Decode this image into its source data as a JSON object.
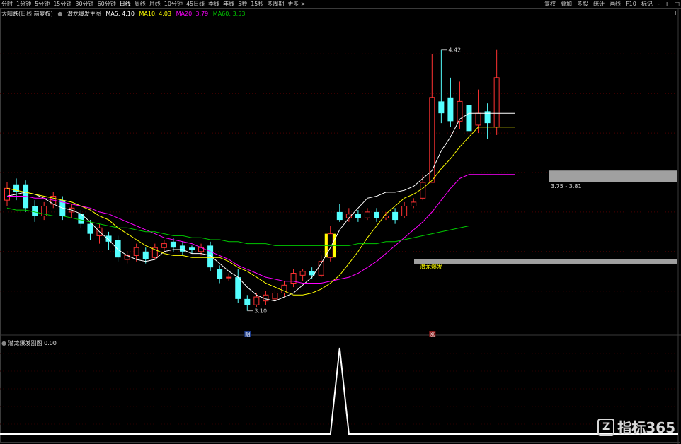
{
  "toolbar": {
    "periods": [
      {
        "label": "分时"
      },
      {
        "label": "1分钟"
      },
      {
        "label": "5分钟"
      },
      {
        "label": "15分钟"
      },
      {
        "label": "30分钟"
      },
      {
        "label": "60分钟"
      },
      {
        "label": "日线",
        "active": true
      },
      {
        "label": "周线"
      },
      {
        "label": "月线"
      },
      {
        "label": "10分钟"
      },
      {
        "label": "45日线"
      },
      {
        "label": "季线"
      },
      {
        "label": "年线"
      },
      {
        "label": "5秒"
      },
      {
        "label": "15秒"
      },
      {
        "label": "多周期"
      },
      {
        "label": "更多 >"
      }
    ],
    "right": [
      "复权",
      "叠加",
      "多股",
      "统计",
      "画线",
      "F10",
      "标记",
      "-",
      "+",
      "□"
    ]
  },
  "main_legend": {
    "period_label": "大阳跌(日线 前复权)",
    "indicator_name": "潜龙爆发主图",
    "ma5": "MA5: 4.10",
    "ma10": "MA10: 4.03",
    "ma20": "MA20: 3.79",
    "ma60": "MA60: 3.53"
  },
  "sub_legend": {
    "indicator_name": "潜龙爆发副图",
    "value": "0.00"
  },
  "annotations": {
    "high_price": "4.42",
    "low_price": "3.10",
    "zone_label": "3.75 - 3.81",
    "signal_label": "潜龙爆发"
  },
  "markers": {
    "low_marker": "阴",
    "limit_up_marker": "涨"
  },
  "watermark": {
    "logo_glyph": "Z",
    "brand": "指标365"
  },
  "colors": {
    "up": "#ff3232",
    "down": "#54ffff",
    "ma5": "#ffffff",
    "ma10": "#ffff00",
    "ma20": "#ff00ff",
    "ma60": "#00c800",
    "zone": "#a0a0a0",
    "signal": "#ffff00",
    "signal_text": "#ffff00"
  },
  "chart_data": {
    "type": "candlestick",
    "title": "潜龙爆发主图",
    "series": [
      {
        "name": "MA5",
        "values": [
          3.68,
          3.69,
          3.7,
          3.69,
          3.67,
          3.64,
          3.62,
          3.61,
          3.59,
          3.55,
          3.5,
          3.46,
          3.41,
          3.38,
          3.36,
          3.35,
          3.36,
          3.4,
          3.41,
          3.41,
          3.39,
          3.39,
          3.38,
          3.34,
          3.3,
          3.27,
          3.22,
          3.18,
          3.16,
          3.15,
          3.17,
          3.19,
          3.23,
          3.27,
          3.34,
          3.42,
          3.51,
          3.57,
          3.62,
          3.67,
          3.68,
          3.7,
          3.7,
          3.71,
          3.73,
          3.77,
          3.81,
          3.91,
          3.98,
          4.07,
          4.1,
          4.1,
          4.1,
          4.1,
          4.1,
          4.1
        ]
      },
      {
        "name": "MA10",
        "values": [
          3.72,
          3.71,
          3.7,
          3.69,
          3.68,
          3.67,
          3.66,
          3.65,
          3.63,
          3.61,
          3.58,
          3.56,
          3.52,
          3.49,
          3.46,
          3.43,
          3.41,
          3.39,
          3.38,
          3.38,
          3.37,
          3.37,
          3.37,
          3.37,
          3.35,
          3.32,
          3.3,
          3.27,
          3.24,
          3.22,
          3.2,
          3.18,
          3.18,
          3.19,
          3.21,
          3.24,
          3.28,
          3.34,
          3.4,
          3.47,
          3.53,
          3.59,
          3.63,
          3.67,
          3.69,
          3.72,
          3.76,
          3.82,
          3.87,
          3.93,
          3.98,
          4.03,
          4.03,
          4.03,
          4.03,
          4.03
        ]
      },
      {
        "name": "MA20",
        "values": [
          3.68,
          3.68,
          3.68,
          3.67,
          3.67,
          3.66,
          3.65,
          3.64,
          3.63,
          3.62,
          3.6,
          3.59,
          3.57,
          3.55,
          3.53,
          3.51,
          3.49,
          3.47,
          3.46,
          3.45,
          3.44,
          3.42,
          3.4,
          3.38,
          3.36,
          3.33,
          3.31,
          3.29,
          3.27,
          3.26,
          3.25,
          3.25,
          3.24,
          3.24,
          3.24,
          3.25,
          3.26,
          3.27,
          3.29,
          3.32,
          3.35,
          3.39,
          3.43,
          3.47,
          3.51,
          3.55,
          3.6,
          3.66,
          3.72,
          3.77,
          3.79,
          3.79,
          3.79,
          3.79,
          3.79,
          3.79
        ]
      },
      {
        "name": "MA60",
        "values": [
          3.62,
          3.61,
          3.61,
          3.6,
          3.59,
          3.58,
          3.58,
          3.57,
          3.56,
          3.55,
          3.54,
          3.53,
          3.52,
          3.52,
          3.51,
          3.5,
          3.5,
          3.49,
          3.48,
          3.48,
          3.47,
          3.47,
          3.46,
          3.46,
          3.45,
          3.45,
          3.44,
          3.44,
          3.44,
          3.43,
          3.43,
          3.43,
          3.43,
          3.43,
          3.43,
          3.43,
          3.43,
          3.43,
          3.44,
          3.44,
          3.44,
          3.45,
          3.45,
          3.46,
          3.47,
          3.48,
          3.49,
          3.5,
          3.51,
          3.52,
          3.53,
          3.53,
          3.53,
          3.53,
          3.53,
          3.53
        ]
      }
    ],
    "candles": [
      [
        3.66,
        3.72,
        3.75,
        3.63
      ],
      [
        3.74,
        3.7,
        3.77,
        3.66
      ],
      [
        3.74,
        3.62,
        3.76,
        3.6
      ],
      [
        3.63,
        3.58,
        3.66,
        3.55
      ],
      [
        3.58,
        3.63,
        3.65,
        3.56
      ],
      [
        3.64,
        3.68,
        3.7,
        3.62
      ],
      [
        3.66,
        3.58,
        3.68,
        3.56
      ],
      [
        3.6,
        3.62,
        3.64,
        3.57
      ],
      [
        3.59,
        3.54,
        3.61,
        3.52
      ],
      [
        3.54,
        3.49,
        3.56,
        3.46
      ],
      [
        3.48,
        3.52,
        3.54,
        3.44
      ],
      [
        3.48,
        3.45,
        3.5,
        3.41
      ],
      [
        3.46,
        3.37,
        3.48,
        3.35
      ],
      [
        3.36,
        3.38,
        3.4,
        3.34
      ],
      [
        3.38,
        3.42,
        3.44,
        3.35
      ],
      [
        3.4,
        3.36,
        3.42,
        3.34
      ],
      [
        3.37,
        3.42,
        3.44,
        3.36
      ],
      [
        3.42,
        3.44,
        3.46,
        3.4
      ],
      [
        3.45,
        3.42,
        3.47,
        3.4
      ],
      [
        3.43,
        3.4,
        3.45,
        3.38
      ],
      [
        3.42,
        3.41,
        3.43,
        3.39
      ],
      [
        3.4,
        3.42,
        3.44,
        3.38
      ],
      [
        3.43,
        3.32,
        3.45,
        3.3
      ],
      [
        3.31,
        3.26,
        3.33,
        3.24
      ],
      [
        3.27,
        3.27,
        3.29,
        3.25
      ],
      [
        3.27,
        3.16,
        3.31,
        3.14
      ],
      [
        3.16,
        3.13,
        3.18,
        3.1
      ],
      [
        3.13,
        3.17,
        3.19,
        3.12
      ],
      [
        3.15,
        3.18,
        3.2,
        3.13
      ],
      [
        3.16,
        3.19,
        3.21,
        3.14
      ],
      [
        3.19,
        3.23,
        3.25,
        3.17
      ],
      [
        3.24,
        3.29,
        3.31,
        3.22
      ],
      [
        3.28,
        3.3,
        3.31,
        3.25
      ],
      [
        3.3,
        3.28,
        3.32,
        3.26
      ],
      [
        3.28,
        3.35,
        3.38,
        3.27
      ],
      [
        3.37,
        3.49,
        3.53,
        3.35
      ],
      [
        3.6,
        3.56,
        3.64,
        3.55
      ],
      [
        3.57,
        3.59,
        3.62,
        3.55
      ],
      [
        3.59,
        3.57,
        3.61,
        3.55
      ],
      [
        3.57,
        3.6,
        3.62,
        3.56
      ],
      [
        3.6,
        3.57,
        3.62,
        3.55
      ],
      [
        3.57,
        3.58,
        3.6,
        3.56
      ],
      [
        3.6,
        3.56,
        3.62,
        3.54
      ],
      [
        3.58,
        3.63,
        3.65,
        3.57
      ],
      [
        3.63,
        3.65,
        3.67,
        3.62
      ],
      [
        3.67,
        3.75,
        3.79,
        3.66
      ],
      [
        3.75,
        4.18,
        4.4,
        3.75
      ],
      [
        4.16,
        4.1,
        4.42,
        4.05
      ],
      [
        4.18,
        4.06,
        4.28,
        4.03
      ],
      [
        4.06,
        4.16,
        4.26,
        4.02
      ],
      [
        4.14,
        4.01,
        4.27,
        3.98
      ],
      [
        4.04,
        4.1,
        4.22,
        4.0
      ],
      [
        4.11,
        4.05,
        4.15,
        3.97
      ],
      [
        4.03,
        4.28,
        4.42,
        3.99
      ]
    ],
    "ylim": [
      3.02,
      4.58
    ],
    "zones": [
      {
        "label": "3.75 - 3.81",
        "low": 3.75,
        "high": 3.81
      },
      {
        "label": "潜龙爆发",
        "low": 3.35,
        "high": 3.36
      }
    ],
    "signal_bars": [
      {
        "index": 35,
        "low": 3.37,
        "high": 3.49
      }
    ],
    "sub_chart": {
      "title": "潜龙爆发副图",
      "values": [
        0,
        0,
        0,
        0,
        0,
        0,
        0,
        0,
        0,
        0,
        0,
        0,
        0,
        0,
        0,
        0,
        0,
        0,
        0,
        0,
        0,
        0,
        0,
        0,
        0,
        0,
        0,
        0,
        0,
        0,
        0,
        0,
        0,
        0,
        0,
        0,
        1,
        0,
        0,
        0,
        0,
        0,
        0,
        0,
        0,
        0,
        0,
        0,
        0,
        0,
        0,
        0,
        0,
        0,
        0,
        0
      ],
      "ylim": [
        0,
        1
      ]
    }
  }
}
